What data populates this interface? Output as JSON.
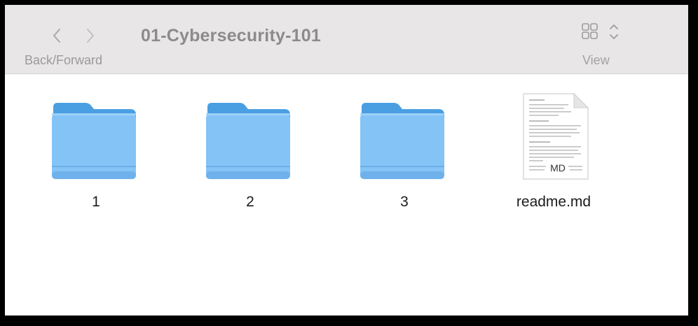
{
  "toolbar": {
    "title": "01-Cybersecurity-101",
    "nav_label": "Back/Forward",
    "view_label": "View"
  },
  "items": [
    {
      "name": "1",
      "kind": "folder",
      "icon": "folder-icon"
    },
    {
      "name": "2",
      "kind": "folder",
      "icon": "folder-icon"
    },
    {
      "name": "3",
      "kind": "folder",
      "icon": "folder-icon"
    },
    {
      "name": "readme.md",
      "kind": "markdown-file",
      "icon": "markdown-file-icon",
      "badge": "MD"
    }
  ],
  "colors": {
    "folder_back": "#4a9fe2",
    "folder_front": "#84c3f6",
    "toolbar_bg": "#e8e6e6",
    "muted_text": "#9b9999"
  }
}
